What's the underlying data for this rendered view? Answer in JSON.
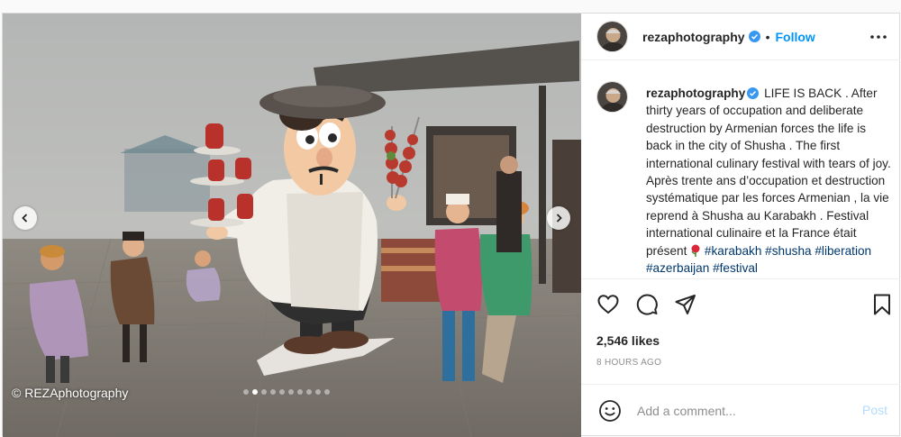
{
  "post": {
    "username": "rezaphotography",
    "follow_label": "Follow",
    "separator": "•",
    "watermark": "© REZAphotography",
    "carousel": {
      "total_slides": 10,
      "active_slide": 2
    },
    "caption": {
      "username": "rezaphotography",
      "text_before_rose": "LIFE IS BACK . After thirty years of occupation and deliberate destruction by Armenian forces the life is back in the city of Shusha . The first international culinary festival with tears of joy. Après trente ans d’occupation et destruction systématique par les forces Armenian , la vie reprend à Shusha au Karabakh . Festival international culinaire et la France était présent",
      "hashtags": [
        "#karabakh",
        "#shusha",
        "#liberation",
        "#azerbaijan",
        "#festival"
      ]
    },
    "likes": "2,546 likes",
    "time": "8 HOURS AGO",
    "comment": {
      "placeholder": "Add a comment...",
      "post_label": "Post"
    },
    "icons": {
      "like": "heart-icon",
      "comment": "comment-icon",
      "share": "paper-plane-icon",
      "save": "bookmark-icon",
      "emoji": "smiley-icon",
      "more": "more-options-icon",
      "verified": "verified-badge-icon",
      "prev": "chevron-left-icon",
      "next": "chevron-right-icon"
    },
    "colors": {
      "accent": "#0095f6",
      "hashtag": "#00376b",
      "muted": "#8e8e8e",
      "post_disabled": "#b3dbff"
    }
  }
}
